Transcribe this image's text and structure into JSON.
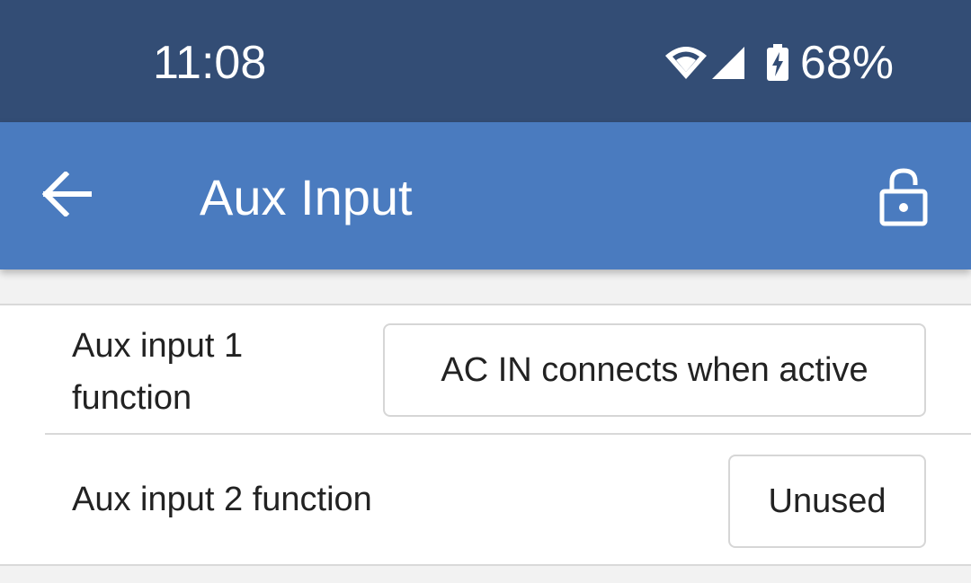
{
  "status_bar": {
    "time": "11:08",
    "battery_percent": "68%",
    "icons": [
      "wifi-icon",
      "cell-signal-icon",
      "battery-charging-icon"
    ]
  },
  "app_bar": {
    "title": "Aux Input",
    "back_icon": "arrow-left-icon",
    "lock_icon": "lock-open-icon"
  },
  "settings": {
    "rows": [
      {
        "label": "Aux input 1 function",
        "value": "AC IN connects when active"
      },
      {
        "label": "Aux input 2 function",
        "value": "Unused"
      }
    ]
  },
  "colors": {
    "status_bar": "#334d75",
    "app_bar": "#4a7bbf",
    "background": "#f2f2f2"
  }
}
